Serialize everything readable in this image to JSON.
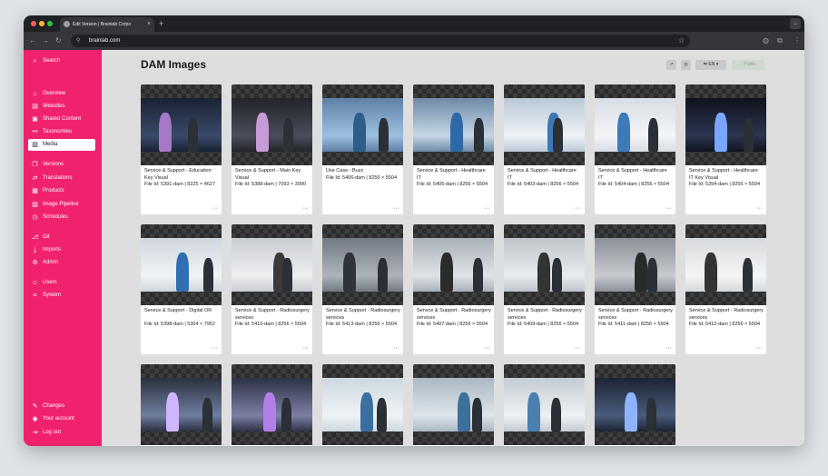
{
  "browser": {
    "tab_title": "Edit Version | Brainlab Corpo",
    "new_tab": "+",
    "close": "×",
    "url": "brainlab.com",
    "icons": [
      "back-icon",
      "forward-icon",
      "reload-icon",
      "site-info-icon",
      "star-icon",
      "extension-icon",
      "puzzle-icon",
      "menu-icon"
    ]
  },
  "sidebar": {
    "items": [
      {
        "label": "Search",
        "icon": "⌕"
      },
      {
        "label": "Overview",
        "icon": "⌂"
      },
      {
        "label": "Websites",
        "icon": "▤"
      },
      {
        "label": "Shared Content",
        "icon": "▣"
      },
      {
        "label": "Taxonomies",
        "icon": "⚯"
      },
      {
        "label": "Media",
        "icon": "▧"
      },
      {
        "label": "Versions",
        "icon": "❐"
      },
      {
        "label": "Translations",
        "icon": "⇄"
      },
      {
        "label": "Products",
        "icon": "▦"
      },
      {
        "label": "Image Pipeline",
        "icon": "▨"
      },
      {
        "label": "Schedules",
        "icon": "◷"
      },
      {
        "label": "Git",
        "icon": "⎇"
      },
      {
        "label": "Imports",
        "icon": "⤓"
      },
      {
        "label": "Admin",
        "icon": "⚙"
      },
      {
        "label": "Users",
        "icon": "☺"
      },
      {
        "label": "System",
        "icon": "⌗"
      },
      {
        "label": "Changes",
        "icon": "✎"
      },
      {
        "label": "Your account",
        "icon": "◉"
      },
      {
        "label": "Log out",
        "icon": "⇥"
      }
    ]
  },
  "main": {
    "title": "DAM Images",
    "toolbar": {
      "open_icon": "↗",
      "settings_icon": "◎",
      "language": "EN",
      "language_icon": "⇆",
      "chevron": "▾",
      "public_label": "Public",
      "public_icon": "◌"
    },
    "more_icon": "···",
    "cards": [
      {
        "title": "Service & Support - Education Key Visual",
        "meta": "File Id: 5391-dam | 8225 × 4627",
        "lines": 2
      },
      {
        "title": "Service & Support - Main Key Visual",
        "meta": "File Id: 5388-dam | 7093 × 3990",
        "lines": 2
      },
      {
        "title": "Use Case - Buzz",
        "meta": "File Id: 5406-dam | 8256 × 5504",
        "lines": 1
      },
      {
        "title": "Service & Support - Healthcare IT",
        "meta": "File Id: 5405-dam | 8256 × 5504",
        "lines": 2
      },
      {
        "title": "Service & Support - Healthcare IT",
        "meta": "File Id: 5403-dam | 8256 × 5504",
        "lines": 2
      },
      {
        "title": "Service & Support - Healthcare IT",
        "meta": "File Id: 5404-dam | 8256 × 5504",
        "lines": 2
      },
      {
        "title": "Service & Support - Healthcare IT Key Visual",
        "meta": "File Id: 5394-dam | 8256 × 5504",
        "lines": 2
      },
      {
        "title": "Service & Support - Digital OR",
        "meta": "File Id: 5398-dam | 5304 × 7952",
        "lines": 2
      },
      {
        "title": "Service & Support - Radiosurgery services",
        "meta": "File Id: 5410-dam | 8256 × 5504",
        "lines": 2
      },
      {
        "title": "Service & Support - Radiosurgery services",
        "meta": "File Id: 5413-dam | 8256 × 5504",
        "lines": 2
      },
      {
        "title": "Service & Support - Radiosurgery services",
        "meta": "File Id: 5407-dam | 8256 × 5504",
        "lines": 2
      },
      {
        "title": "Service & Support - Radiosurgery services",
        "meta": "File Id: 5409-dam | 8256 × 5504",
        "lines": 2
      },
      {
        "title": "Service & Support - Radiosurgery services",
        "meta": "File Id: 5411-dam | 8256 × 5504",
        "lines": 2
      },
      {
        "title": "Service & Support - Radiosurgery services",
        "meta": "File Id: 5412-dam | 8256 × 5504",
        "lines": 2
      },
      {
        "title": "",
        "meta": "",
        "lines": 0
      },
      {
        "title": "",
        "meta": "",
        "lines": 0
      },
      {
        "title": "",
        "meta": "",
        "lines": 0
      },
      {
        "title": "",
        "meta": "",
        "lines": 0
      },
      {
        "title": "",
        "meta": "",
        "lines": 0
      },
      {
        "title": "",
        "meta": "",
        "lines": 0
      }
    ]
  },
  "colors": {
    "brand": "#f0216f",
    "content_bg": "#dedede",
    "chrome_dark": "#202124"
  }
}
